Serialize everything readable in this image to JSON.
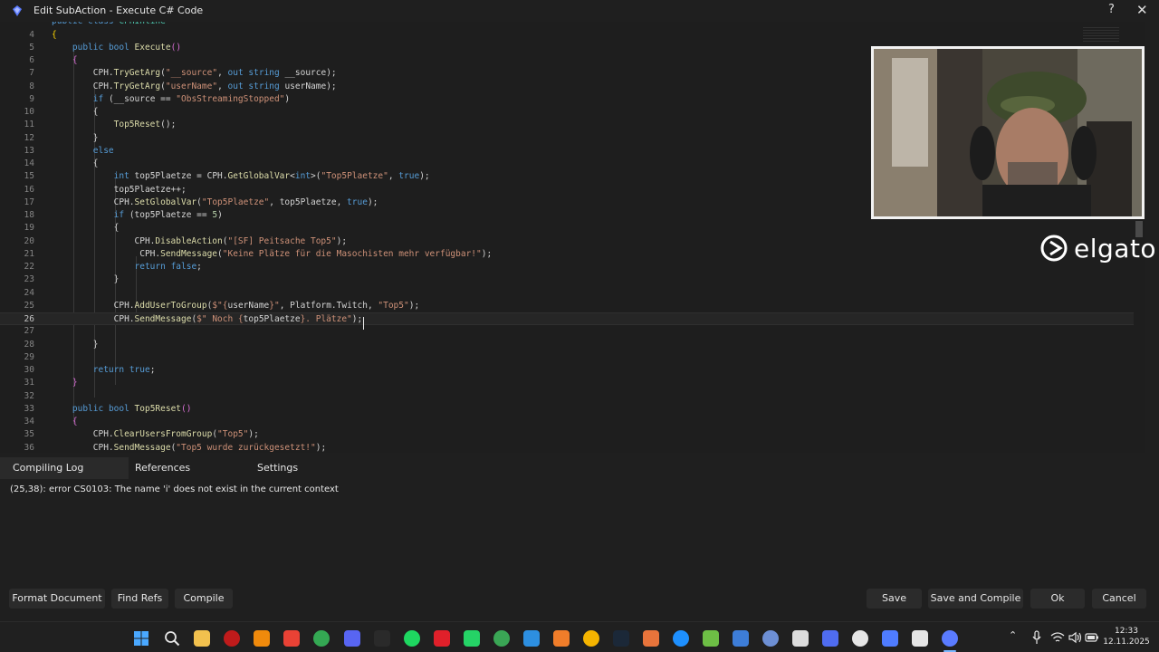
{
  "window": {
    "title": "Edit SubAction - Execute C# Code",
    "help_label": "?",
    "close_label": "✕"
  },
  "editor": {
    "current_line": 26,
    "lines": [
      {
        "n": "",
        "tokens": [
          [
            "kw",
            "public "
          ],
          [
            "kw",
            "class "
          ],
          [
            "type",
            "CPHInline"
          ]
        ]
      },
      {
        "n": "4",
        "tokens": [
          [
            "br",
            "{"
          ]
        ]
      },
      {
        "n": "5",
        "tokens": [
          [
            "id",
            "    "
          ],
          [
            "kw",
            "public "
          ],
          [
            "kw",
            "bool "
          ],
          [
            "method",
            "Execute"
          ],
          [
            "br2",
            "()"
          ]
        ]
      },
      {
        "n": "6",
        "tokens": [
          [
            "id",
            "    "
          ],
          [
            "br2",
            "{"
          ]
        ]
      },
      {
        "n": "7",
        "tokens": [
          [
            "id",
            "        CPH."
          ],
          [
            "method",
            "TryGetArg"
          ],
          [
            "id",
            "("
          ],
          [
            "str",
            "\"__source\""
          ],
          [
            "id",
            ", "
          ],
          [
            "kw",
            "out "
          ],
          [
            "kw",
            "string "
          ],
          [
            "id",
            "__source);"
          ]
        ]
      },
      {
        "n": "8",
        "tokens": [
          [
            "id",
            "        CPH."
          ],
          [
            "method",
            "TryGetArg"
          ],
          [
            "id",
            "("
          ],
          [
            "str",
            "\"userName\""
          ],
          [
            "id",
            ", "
          ],
          [
            "kw",
            "out "
          ],
          [
            "kw",
            "string "
          ],
          [
            "id",
            "userName);"
          ]
        ]
      },
      {
        "n": "9",
        "tokens": [
          [
            "id",
            "        "
          ],
          [
            "ctl",
            "if "
          ],
          [
            "id",
            "(__source == "
          ],
          [
            "str",
            "\"ObsStreamingStopped\""
          ],
          [
            "id",
            ")"
          ]
        ]
      },
      {
        "n": "10",
        "tokens": [
          [
            "id",
            "        {"
          ]
        ]
      },
      {
        "n": "11",
        "tokens": [
          [
            "id",
            "            "
          ],
          [
            "method",
            "Top5Reset"
          ],
          [
            "id",
            "();"
          ]
        ]
      },
      {
        "n": "12",
        "tokens": [
          [
            "id",
            "        }"
          ]
        ]
      },
      {
        "n": "13",
        "tokens": [
          [
            "id",
            "        "
          ],
          [
            "ctl",
            "else"
          ]
        ]
      },
      {
        "n": "14",
        "tokens": [
          [
            "id",
            "        {"
          ]
        ]
      },
      {
        "n": "15",
        "tokens": [
          [
            "id",
            "            "
          ],
          [
            "kw",
            "int "
          ],
          [
            "id",
            "top5Plaetze = CPH."
          ],
          [
            "method",
            "GetGlobalVar"
          ],
          [
            "id",
            "<"
          ],
          [
            "kw",
            "int"
          ],
          [
            "id",
            ">("
          ],
          [
            "str",
            "\"Top5Plaetze\""
          ],
          [
            "id",
            ", "
          ],
          [
            "kw",
            "true"
          ],
          [
            "id",
            ");"
          ]
        ]
      },
      {
        "n": "16",
        "tokens": [
          [
            "id",
            "            top5Plaetze++;"
          ]
        ]
      },
      {
        "n": "17",
        "tokens": [
          [
            "id",
            "            CPH."
          ],
          [
            "method",
            "SetGlobalVar"
          ],
          [
            "id",
            "("
          ],
          [
            "str",
            "\"Top5Plaetze\""
          ],
          [
            "id",
            ", top5Plaetze, "
          ],
          [
            "kw",
            "true"
          ],
          [
            "id",
            ");"
          ]
        ]
      },
      {
        "n": "18",
        "tokens": [
          [
            "id",
            "            "
          ],
          [
            "ctl",
            "if "
          ],
          [
            "id",
            "(top5Plaetze == "
          ],
          [
            "num",
            "5"
          ],
          [
            "id",
            ")"
          ]
        ]
      },
      {
        "n": "19",
        "tokens": [
          [
            "id",
            "            {"
          ]
        ]
      },
      {
        "n": "20",
        "tokens": [
          [
            "id",
            "                CPH."
          ],
          [
            "method",
            "DisableAction"
          ],
          [
            "id",
            "("
          ],
          [
            "str",
            "\"[SF] Peitsache Top5\""
          ],
          [
            "id",
            ");"
          ]
        ]
      },
      {
        "n": "21",
        "tokens": [
          [
            "id",
            "                 CPH."
          ],
          [
            "method",
            "SendMessage"
          ],
          [
            "id",
            "("
          ],
          [
            "str",
            "\"Keine Plätze für die Masochisten mehr verfügbar!\""
          ],
          [
            "id",
            ");"
          ]
        ]
      },
      {
        "n": "22",
        "tokens": [
          [
            "id",
            "                "
          ],
          [
            "ctl",
            "return "
          ],
          [
            "kw",
            "false"
          ],
          [
            "id",
            ";"
          ]
        ]
      },
      {
        "n": "23",
        "tokens": [
          [
            "id",
            "            }"
          ]
        ]
      },
      {
        "n": "24",
        "tokens": []
      },
      {
        "n": "25",
        "tokens": [
          [
            "id",
            "            CPH."
          ],
          [
            "method",
            "AddUserToGroup"
          ],
          [
            "id",
            "("
          ],
          [
            "str",
            "$\"{"
          ],
          [
            "id",
            "userName"
          ],
          [
            "str",
            "}\""
          ],
          [
            "id",
            ", Platform.Twitch, "
          ],
          [
            "str",
            "\"Top5\""
          ],
          [
            "id",
            ");"
          ]
        ]
      },
      {
        "n": "26",
        "tokens": [
          [
            "id",
            "            CPH."
          ],
          [
            "method",
            "SendMessage"
          ],
          [
            "id",
            "("
          ],
          [
            "str",
            "$\" Noch {"
          ],
          [
            "id",
            "top5Plaetze"
          ],
          [
            "str",
            "}. Plätze\""
          ],
          [
            "id",
            ");"
          ]
        ]
      },
      {
        "n": "27",
        "tokens": []
      },
      {
        "n": "28",
        "tokens": [
          [
            "id",
            "        }"
          ]
        ]
      },
      {
        "n": "29",
        "tokens": []
      },
      {
        "n": "30",
        "tokens": [
          [
            "id",
            "        "
          ],
          [
            "ctl",
            "return "
          ],
          [
            "kw",
            "true"
          ],
          [
            "id",
            ";"
          ]
        ]
      },
      {
        "n": "31",
        "tokens": [
          [
            "id",
            "    "
          ],
          [
            "br2",
            "}"
          ]
        ]
      },
      {
        "n": "32",
        "tokens": []
      },
      {
        "n": "33",
        "tokens": [
          [
            "id",
            "    "
          ],
          [
            "kw",
            "public "
          ],
          [
            "kw",
            "bool "
          ],
          [
            "method",
            "Top5Reset"
          ],
          [
            "br2",
            "()"
          ]
        ]
      },
      {
        "n": "34",
        "tokens": [
          [
            "id",
            "    "
          ],
          [
            "br2",
            "{"
          ]
        ]
      },
      {
        "n": "35",
        "tokens": [
          [
            "id",
            "        CPH."
          ],
          [
            "method",
            "ClearUsersFromGroup"
          ],
          [
            "id",
            "("
          ],
          [
            "str",
            "\"Top5\""
          ],
          [
            "id",
            ");"
          ]
        ]
      },
      {
        "n": "36",
        "tokens": [
          [
            "id",
            "        CPH."
          ],
          [
            "method",
            "SendMessage"
          ],
          [
            "id",
            "("
          ],
          [
            "str",
            "\"Top5 wurde zurückgesetzt!\""
          ],
          [
            "id",
            ");"
          ]
        ]
      }
    ]
  },
  "overlay": {
    "brand": "elgato"
  },
  "bottom_tabs": [
    {
      "label": "Compiling Log",
      "active": true
    },
    {
      "label": "References",
      "active": false
    },
    {
      "label": "Settings",
      "active": false
    }
  ],
  "compile_log": {
    "message": "(25,38): error CS0103: The name 'i' does not exist in the current context"
  },
  "buttons": {
    "format_document": "Format Document",
    "find_refs": "Find Refs",
    "compile": "Compile",
    "save": "Save",
    "save_and_compile": "Save and Compile",
    "ok": "Ok",
    "cancel": "Cancel"
  },
  "taskbar": {
    "icons": [
      {
        "name": "windows-start-icon",
        "color": "#4aa8ff"
      },
      {
        "name": "search-icon",
        "color": "#e6e6e6"
      },
      {
        "name": "file-explorer-icon",
        "color": "#f2c14e"
      },
      {
        "name": "filezilla-icon",
        "color": "#bf1b1b"
      },
      {
        "name": "vlc-icon",
        "color": "#f08a0c"
      },
      {
        "name": "chrome-icon",
        "color": "#e94235"
      },
      {
        "name": "chrome-alt-icon",
        "color": "#34a853"
      },
      {
        "name": "discord-icon",
        "color": "#5865f2"
      },
      {
        "name": "epic-games-icon",
        "color": "#2a2a2a"
      },
      {
        "name": "spotify-icon",
        "color": "#1ed760"
      },
      {
        "name": "red-app-icon",
        "color": "#e0202a"
      },
      {
        "name": "whatsapp-icon",
        "color": "#25d366"
      },
      {
        "name": "green-editor-icon",
        "color": "#3aa655"
      },
      {
        "name": "vscode-icon",
        "color": "#2d8fe0"
      },
      {
        "name": "orange-app-icon",
        "color": "#f07d2a"
      },
      {
        "name": "rockstar-icon",
        "color": "#f5b400"
      },
      {
        "name": "steam-icon",
        "color": "#1b2838"
      },
      {
        "name": "xbox-orange-icon",
        "color": "#e8743b"
      },
      {
        "name": "blue-square-icon",
        "color": "#1e90ff"
      },
      {
        "name": "cube-icon",
        "color": "#6dbe45"
      },
      {
        "name": "blue-orb-icon",
        "color": "#3d7dd8"
      },
      {
        "name": "monitor-tool-icon",
        "color": "#6d8fd4"
      },
      {
        "name": "obs-icon",
        "color": "#dcdcdc"
      },
      {
        "name": "streamerbot-icon",
        "color": "#4f6cf0"
      },
      {
        "name": "camera-hub-icon",
        "color": "#e6e6e6"
      },
      {
        "name": "stream-deck-icon",
        "color": "#4f7cff"
      },
      {
        "name": "wave-link-icon",
        "color": "#e6e6e6"
      },
      {
        "name": "streamerbot-active-icon",
        "color": "#5a7bff"
      }
    ],
    "clock_time": "12:33",
    "clock_date": "12.11.2025"
  }
}
